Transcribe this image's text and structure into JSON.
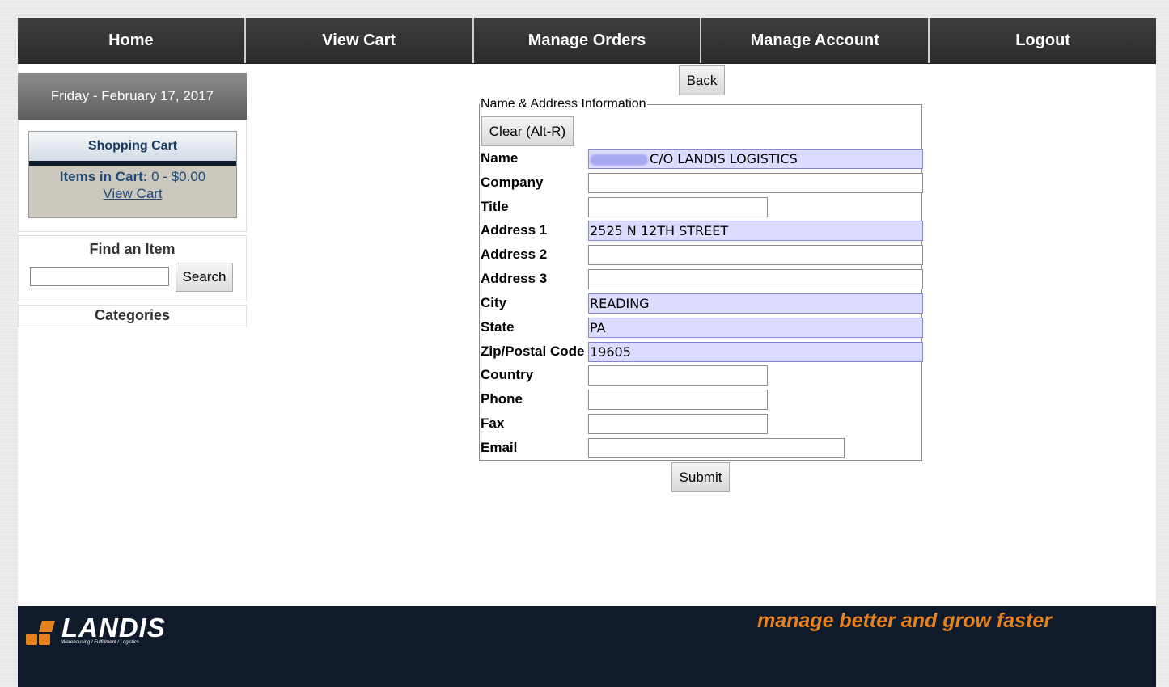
{
  "nav": {
    "items": [
      "Home",
      "View Cart",
      "Manage Orders",
      "Manage Account",
      "Logout"
    ]
  },
  "sidebar": {
    "date": "Friday - February 17, 2017",
    "cart": {
      "title": "Shopping Cart",
      "items_label": "Items in Cart:",
      "items_value": " 0 - $0.00",
      "view_link": "View Cart"
    },
    "find": {
      "title": "Find an Item",
      "input_value": "",
      "search_label": "Search"
    },
    "categories_label": "Categories"
  },
  "form": {
    "back_label": "Back",
    "legend": "Name & Address Information",
    "clear_label": "Clear (Alt-R)",
    "submit_label": "Submit",
    "fields": [
      {
        "label": "Name",
        "value": "C/O LANDIS LOGISTICS",
        "filled": true,
        "redacted": true
      },
      {
        "label": "Company",
        "value": "",
        "filled": false
      },
      {
        "label": "Title",
        "value": "",
        "filled": false
      },
      {
        "label": "Address 1",
        "value": "2525 N 12TH STREET",
        "filled": true
      },
      {
        "label": "Address 2",
        "value": "",
        "filled": false
      },
      {
        "label": "Address 3",
        "value": "",
        "filled": false
      },
      {
        "label": "City",
        "value": "READING",
        "filled": true
      },
      {
        "label": "State",
        "value": "PA",
        "filled": true
      },
      {
        "label": "Zip/Postal Code",
        "value": "19605",
        "filled": true
      },
      {
        "label": "Country",
        "value": "",
        "filled": false
      },
      {
        "label": "Phone",
        "value": "",
        "filled": false
      },
      {
        "label": "Fax",
        "value": "",
        "filled": false
      },
      {
        "label": "Email",
        "value": "",
        "filled": false
      }
    ]
  },
  "footer": {
    "logo_text": "LANDIS",
    "logo_subtext": "Warehousing / Fulfillment / Logistics",
    "tagline": "manage better and grow faster"
  },
  "colors": {
    "nav_bg": "#353535",
    "filled_field_bg": "#dcdcff",
    "footer_bg": "#0f1a2b",
    "tagline": "#e6821e",
    "cart_text": "#1f4a78"
  }
}
